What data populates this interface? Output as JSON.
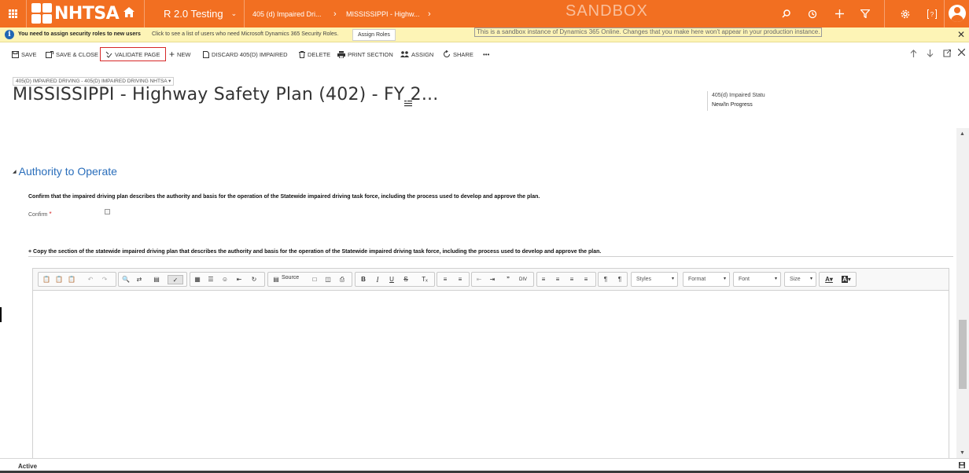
{
  "topnav": {
    "brand": "NHTSA",
    "app_name": "R 2.0 Testing",
    "breadcrumb_1": "405 (d) Impaired Dri...",
    "breadcrumb_2": "MISSISSIPPI - Highw...",
    "sandbox_label": "SANDBOX",
    "color": "#f26f21"
  },
  "notification": {
    "message": "You need to assign security roles to new users",
    "link_text": "Click to see a list of users who need Microsoft Dynamics 365 Security Roles.",
    "button_label": "Assign Roles",
    "sandbox_message": "This is a sandbox instance of Dynamics 365 Online.  Changes that you make here won't appear in your production instance."
  },
  "commands": {
    "save": "SAVE",
    "save_close": "SAVE & CLOSE",
    "validate": "VALIDATE PAGE",
    "new": "NEW",
    "discard": "DISCARD 405(D) IMPAIRED",
    "delete": "DELETE",
    "print": "PRINT SECTION",
    "assign": "ASSIGN",
    "share": "SHARE",
    "more": "•••"
  },
  "header": {
    "form_selector": "405(D) IMPAIRED DRIVING - 405(D) IMPAIRED DRIVING NHTSA",
    "title": "MISSISSIPPI - Highway Safety Plan (402) - FY 2...",
    "field_1": "405(d) Impaired Statu",
    "field_2": "New/In Progress"
  },
  "section": {
    "title": "Authority to Operate",
    "confirm_description": "Confirm that the impaired driving plan describes the authority and basis for the operation of the Statewide impaired driving task force, including the process used to develop and approve the plan.",
    "confirm_label": "Confirm",
    "required_mark": "*",
    "copy_description": "+ Copy the section of the statewide impaired driving plan that describes the authority and basis for the operation of the Statewide impaired driving task force, including the process used to develop and approve the plan."
  },
  "editor": {
    "source_label": "Source",
    "styles_label": "Styles",
    "format_label": "Format",
    "font_label": "Font",
    "size_label": "Size"
  },
  "status": {
    "state": "Active"
  }
}
